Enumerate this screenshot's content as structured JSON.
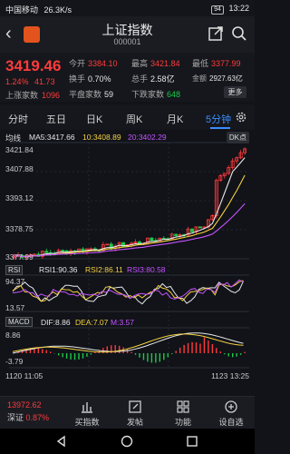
{
  "status_bar": {
    "carrier": "中国移动",
    "speed": "26.3K/s",
    "battery": "94",
    "time": "13:22"
  },
  "header": {
    "title": "上证指数",
    "code": "000001"
  },
  "quote": {
    "price": "3419.46",
    "change_pct": "1.24%",
    "change_abs": "41.73",
    "open_label": "今开",
    "open_value": "3384.10",
    "high_label": "最高",
    "high_value": "3421.84",
    "low_label": "最低",
    "low_value": "3377.99",
    "turnover_label": "换手",
    "turnover_value": "0.70%",
    "volume_label": "总手",
    "volume_value": "2.58亿",
    "amount_label": "金额",
    "amount_value": "2927.63亿",
    "up_label": "上涨家数",
    "up_value": "1096",
    "flat_label": "平盘家数",
    "flat_value": "59",
    "down_label": "下跌家数",
    "down_value": "648",
    "more_label": "更多"
  },
  "tabs": [
    {
      "label": "分时"
    },
    {
      "label": "五日"
    },
    {
      "label": "日K"
    },
    {
      "label": "周K"
    },
    {
      "label": "月K"
    },
    {
      "label": "5分钟"
    }
  ],
  "chart": {
    "main_label": "均线",
    "ma5": "MA5:3417.66",
    "ma10": "10:3408.89",
    "ma20": "20:3402.29",
    "dk_label": "DK点",
    "y_ticks": [
      "3421.84",
      "3407.88",
      "3393.12",
      "3378.75",
      "3377.99"
    ],
    "rsi_box": "RSI",
    "rsi1": "RSI1:90.36",
    "rsi2": "RSI2:86.11",
    "rsi3": "RSI3:80.58",
    "rsi_top": "94.37",
    "rsi_bottom": "13.57",
    "macd_box": "MACD",
    "dif": "DIF:8.86",
    "dea": "DEA:7.07",
    "m": "M:3.57",
    "macd_top": "8.86",
    "macd_bottom": "-3.79",
    "x_start": "1120 11:05",
    "x_end": "1123 13:25"
  },
  "chart_data": {
    "type": "candlestick",
    "ylim": [
      3377.99,
      3421.84
    ],
    "ma_series": [
      "MA5",
      "MA10",
      "MA20"
    ],
    "latest": {
      "ma5": 3417.66,
      "ma10": 3408.89,
      "ma20": 3402.29,
      "rsi1": 90.36,
      "rsi2": 86.11,
      "rsi3": 80.58,
      "dif": 8.86,
      "dea": 7.07,
      "m": 3.57
    }
  },
  "bottom_nav": {
    "sz_name": "深证",
    "sz_price": "13972.62",
    "sz_pct": "0.87%",
    "items": [
      {
        "label": "买指数"
      },
      {
        "label": "发帖"
      },
      {
        "label": "功能"
      },
      {
        "label": "设自选"
      }
    ]
  },
  "colors": {
    "up": "#ff3b3b",
    "down": "#1ec84a",
    "accent": "#3b8dff",
    "background": "#111319"
  }
}
